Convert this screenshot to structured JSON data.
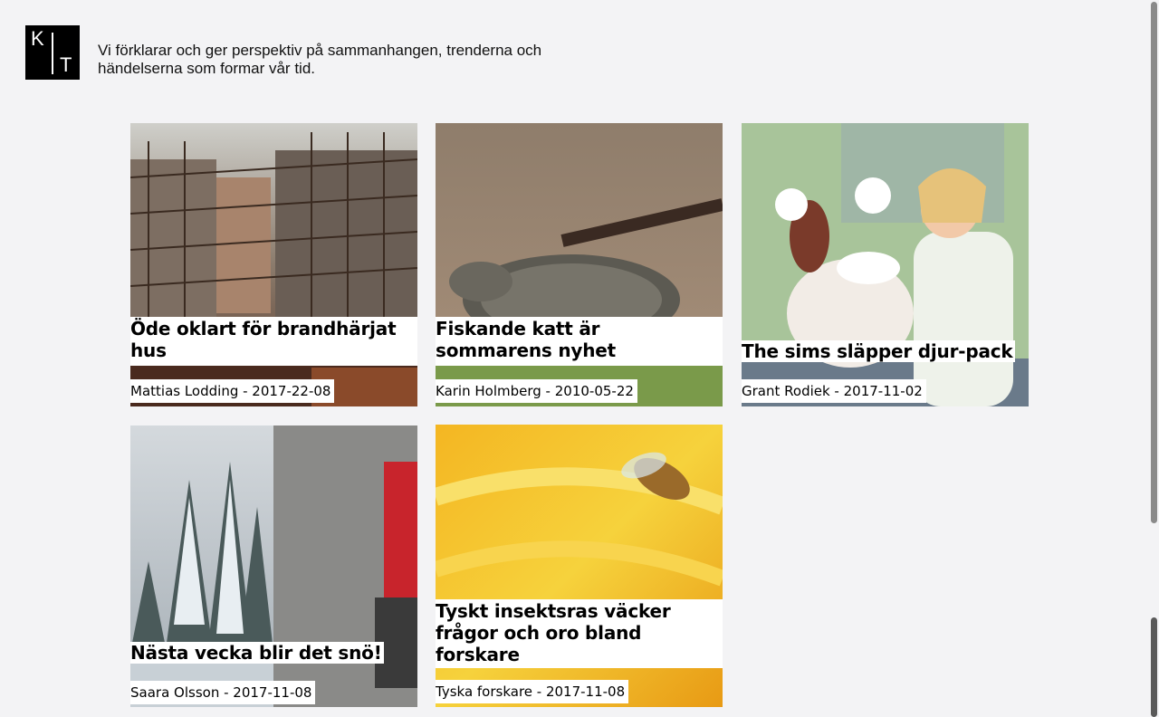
{
  "header": {
    "logo_letters": [
      "K",
      "T"
    ],
    "tagline": "Vi förklarar och ger perspektiv på sammanhangen, trenderna och händelserna som formar vår tid."
  },
  "articles": [
    {
      "title": "Öde oklart för brandhärjat hus",
      "byline": "Mattias Lodding - 2017-22-08",
      "image": "burned-building-scaffolding"
    },
    {
      "title": "Fiskande katt är sommarens nyhet",
      "byline": "Karin Holmberg - 2010-05-22",
      "image": "fishing-cat"
    },
    {
      "title": "The sims släpper djur-pack",
      "byline": "Grant Rodiek - 2017-11-02",
      "image": "sims-dog-vet"
    },
    {
      "title": "Nästa vecka blir det snö!",
      "byline": "Saara Olsson - 2017-11-08",
      "image": "snowy-trees"
    },
    {
      "title": "Tyskt insektsras väcker frågor och oro bland forskare",
      "byline": "Tyska forskare - 2017-11-08",
      "image": "bee-sunflower"
    }
  ],
  "colors": {
    "background": "#f3f3f5",
    "text": "#000000"
  }
}
